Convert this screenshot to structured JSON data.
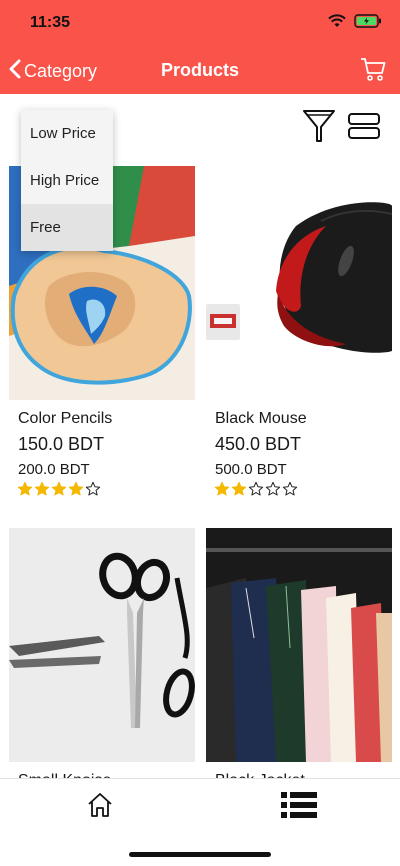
{
  "status_bar": {
    "time": "11:35"
  },
  "nav": {
    "back_label": "Category",
    "title": "Products"
  },
  "sort_menu": {
    "items": [
      {
        "label": "Low Price"
      },
      {
        "label": "High Price"
      },
      {
        "label": "Free"
      }
    ],
    "selected": "Free"
  },
  "products": [
    {
      "name": "Color Pencils",
      "price": "150.0 BDT",
      "old_price": "200.0 BDT",
      "rating": 4,
      "rating_max": 5
    },
    {
      "name": "Black Mouse",
      "price": "450.0 BDT",
      "old_price": "500.0 BDT",
      "rating": 2,
      "rating_max": 5
    },
    {
      "name": "Small Knoise",
      "price": "",
      "old_price": "",
      "rating": 0,
      "rating_max": 5
    },
    {
      "name": "Black Jacket",
      "price": "",
      "old_price": "",
      "rating": 0,
      "rating_max": 5
    }
  ],
  "colors": {
    "accent": "#f9534a",
    "star": "#f5b800"
  }
}
